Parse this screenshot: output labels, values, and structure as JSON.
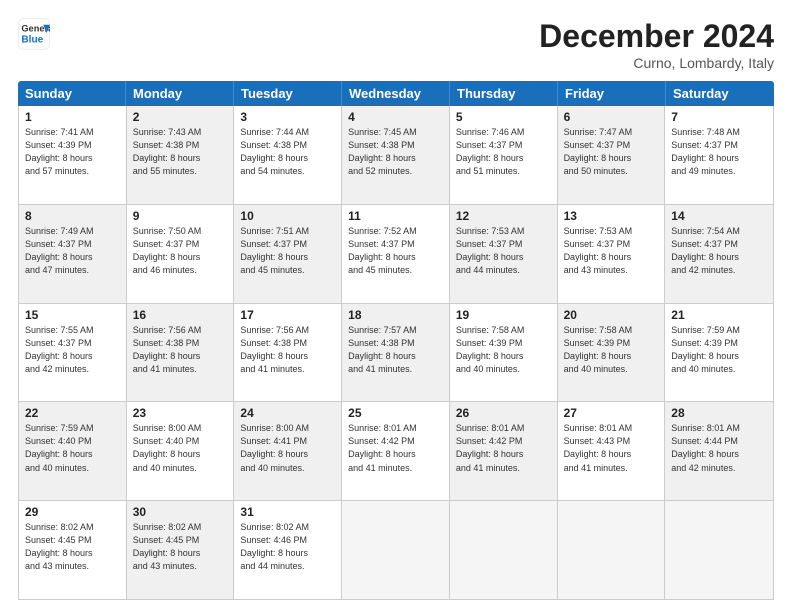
{
  "logo": {
    "line1": "General",
    "line2": "Blue"
  },
  "title": "December 2024",
  "location": "Curno, Lombardy, Italy",
  "header_days": [
    "Sunday",
    "Monday",
    "Tuesday",
    "Wednesday",
    "Thursday",
    "Friday",
    "Saturday"
  ],
  "weeks": [
    [
      {
        "day": "1",
        "rise": "Sunrise: 7:41 AM",
        "set": "Sunset: 4:39 PM",
        "daylight": "Daylight: 8 hours and 57 minutes.",
        "shaded": false
      },
      {
        "day": "2",
        "rise": "Sunrise: 7:43 AM",
        "set": "Sunset: 4:38 PM",
        "daylight": "Daylight: 8 hours and 55 minutes.",
        "shaded": true
      },
      {
        "day": "3",
        "rise": "Sunrise: 7:44 AM",
        "set": "Sunset: 4:38 PM",
        "daylight": "Daylight: 8 hours and 54 minutes.",
        "shaded": false
      },
      {
        "day": "4",
        "rise": "Sunrise: 7:45 AM",
        "set": "Sunset: 4:38 PM",
        "daylight": "Daylight: 8 hours and 52 minutes.",
        "shaded": true
      },
      {
        "day": "5",
        "rise": "Sunrise: 7:46 AM",
        "set": "Sunset: 4:37 PM",
        "daylight": "Daylight: 8 hours and 51 minutes.",
        "shaded": false
      },
      {
        "day": "6",
        "rise": "Sunrise: 7:47 AM",
        "set": "Sunset: 4:37 PM",
        "daylight": "Daylight: 8 hours and 50 minutes.",
        "shaded": true
      },
      {
        "day": "7",
        "rise": "Sunrise: 7:48 AM",
        "set": "Sunset: 4:37 PM",
        "daylight": "Daylight: 8 hours and 49 minutes.",
        "shaded": false
      }
    ],
    [
      {
        "day": "8",
        "rise": "Sunrise: 7:49 AM",
        "set": "Sunset: 4:37 PM",
        "daylight": "Daylight: 8 hours and 47 minutes.",
        "shaded": true
      },
      {
        "day": "9",
        "rise": "Sunrise: 7:50 AM",
        "set": "Sunset: 4:37 PM",
        "daylight": "Daylight: 8 hours and 46 minutes.",
        "shaded": false
      },
      {
        "day": "10",
        "rise": "Sunrise: 7:51 AM",
        "set": "Sunset: 4:37 PM",
        "daylight": "Daylight: 8 hours and 45 minutes.",
        "shaded": true
      },
      {
        "day": "11",
        "rise": "Sunrise: 7:52 AM",
        "set": "Sunset: 4:37 PM",
        "daylight": "Daylight: 8 hours and 45 minutes.",
        "shaded": false
      },
      {
        "day": "12",
        "rise": "Sunrise: 7:53 AM",
        "set": "Sunset: 4:37 PM",
        "daylight": "Daylight: 8 hours and 44 minutes.",
        "shaded": true
      },
      {
        "day": "13",
        "rise": "Sunrise: 7:53 AM",
        "set": "Sunset: 4:37 PM",
        "daylight": "Daylight: 8 hours and 43 minutes.",
        "shaded": false
      },
      {
        "day": "14",
        "rise": "Sunrise: 7:54 AM",
        "set": "Sunset: 4:37 PM",
        "daylight": "Daylight: 8 hours and 42 minutes.",
        "shaded": true
      }
    ],
    [
      {
        "day": "15",
        "rise": "Sunrise: 7:55 AM",
        "set": "Sunset: 4:37 PM",
        "daylight": "Daylight: 8 hours and 42 minutes.",
        "shaded": false
      },
      {
        "day": "16",
        "rise": "Sunrise: 7:56 AM",
        "set": "Sunset: 4:38 PM",
        "daylight": "Daylight: 8 hours and 41 minutes.",
        "shaded": true
      },
      {
        "day": "17",
        "rise": "Sunrise: 7:56 AM",
        "set": "Sunset: 4:38 PM",
        "daylight": "Daylight: 8 hours and 41 minutes.",
        "shaded": false
      },
      {
        "day": "18",
        "rise": "Sunrise: 7:57 AM",
        "set": "Sunset: 4:38 PM",
        "daylight": "Daylight: 8 hours and 41 minutes.",
        "shaded": true
      },
      {
        "day": "19",
        "rise": "Sunrise: 7:58 AM",
        "set": "Sunset: 4:39 PM",
        "daylight": "Daylight: 8 hours and 40 minutes.",
        "shaded": false
      },
      {
        "day": "20",
        "rise": "Sunrise: 7:58 AM",
        "set": "Sunset: 4:39 PM",
        "daylight": "Daylight: 8 hours and 40 minutes.",
        "shaded": true
      },
      {
        "day": "21",
        "rise": "Sunrise: 7:59 AM",
        "set": "Sunset: 4:39 PM",
        "daylight": "Daylight: 8 hours and 40 minutes.",
        "shaded": false
      }
    ],
    [
      {
        "day": "22",
        "rise": "Sunrise: 7:59 AM",
        "set": "Sunset: 4:40 PM",
        "daylight": "Daylight: 8 hours and 40 minutes.",
        "shaded": true
      },
      {
        "day": "23",
        "rise": "Sunrise: 8:00 AM",
        "set": "Sunset: 4:40 PM",
        "daylight": "Daylight: 8 hours and 40 minutes.",
        "shaded": false
      },
      {
        "day": "24",
        "rise": "Sunrise: 8:00 AM",
        "set": "Sunset: 4:41 PM",
        "daylight": "Daylight: 8 hours and 40 minutes.",
        "shaded": true
      },
      {
        "day": "25",
        "rise": "Sunrise: 8:01 AM",
        "set": "Sunset: 4:42 PM",
        "daylight": "Daylight: 8 hours and 41 minutes.",
        "shaded": false
      },
      {
        "day": "26",
        "rise": "Sunrise: 8:01 AM",
        "set": "Sunset: 4:42 PM",
        "daylight": "Daylight: 8 hours and 41 minutes.",
        "shaded": true
      },
      {
        "day": "27",
        "rise": "Sunrise: 8:01 AM",
        "set": "Sunset: 4:43 PM",
        "daylight": "Daylight: 8 hours and 41 minutes.",
        "shaded": false
      },
      {
        "day": "28",
        "rise": "Sunrise: 8:01 AM",
        "set": "Sunset: 4:44 PM",
        "daylight": "Daylight: 8 hours and 42 minutes.",
        "shaded": true
      }
    ],
    [
      {
        "day": "29",
        "rise": "Sunrise: 8:02 AM",
        "set": "Sunset: 4:45 PM",
        "daylight": "Daylight: 8 hours and 43 minutes.",
        "shaded": false
      },
      {
        "day": "30",
        "rise": "Sunrise: 8:02 AM",
        "set": "Sunset: 4:45 PM",
        "daylight": "Daylight: 8 hours and 43 minutes.",
        "shaded": true
      },
      {
        "day": "31",
        "rise": "Sunrise: 8:02 AM",
        "set": "Sunset: 4:46 PM",
        "daylight": "Daylight: 8 hours and 44 minutes.",
        "shaded": false
      },
      {
        "day": "",
        "rise": "",
        "set": "",
        "daylight": "",
        "shaded": true,
        "empty": true
      },
      {
        "day": "",
        "rise": "",
        "set": "",
        "daylight": "",
        "shaded": false,
        "empty": true
      },
      {
        "day": "",
        "rise": "",
        "set": "",
        "daylight": "",
        "shaded": true,
        "empty": true
      },
      {
        "day": "",
        "rise": "",
        "set": "",
        "daylight": "",
        "shaded": false,
        "empty": true
      }
    ]
  ]
}
